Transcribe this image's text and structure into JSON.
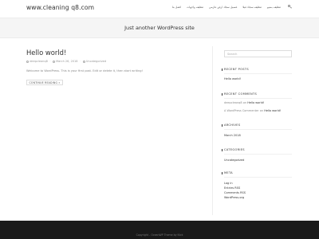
{
  "header": {
    "site_title": "www.cleaning q8.com",
    "nav_items": [
      "تنظيف بمنيو",
      "تنظيف سجاد فيلا",
      "غسيل سجاد ارض عازمي",
      "تنظيف واجهات",
      "اتصل بنا"
    ],
    "search_icon": "search-icon"
  },
  "banner": {
    "tagline": "Just another WordPress site"
  },
  "post": {
    "title": "Hello world!",
    "author": "deepcleanq8",
    "date": "March 26, 2018",
    "category": "Uncategorized",
    "excerpt": "Welcome to WordPress. This is your first post. Edit or delete it, then start writing!",
    "read_more": "CONTINUE READING »"
  },
  "sidebar": {
    "search_placeholder": "Search",
    "recent_posts": {
      "title": "RECENT POSTS",
      "items": [
        "Hello world!"
      ]
    },
    "recent_comments": {
      "title": "RECENT COMMENTS",
      "items": [
        {
          "author": "deepcleanq8",
          "on": "on",
          "post": "Hello world!"
        },
        {
          "author": "A WordPress Commenter",
          "on": "on",
          "post": "Hello world!"
        }
      ]
    },
    "archives": {
      "title": "ARCHIVES",
      "items": [
        "March 2018"
      ]
    },
    "categories": {
      "title": "CATEGORIES",
      "items": [
        "Uncategorized"
      ]
    },
    "meta": {
      "title": "META",
      "items": [
        "Log in",
        "Entries RSS",
        "Comments RSS",
        "WordPress.org"
      ]
    }
  },
  "footer": {
    "copyright": "Copyright - OceanWP Theme by Nick"
  }
}
